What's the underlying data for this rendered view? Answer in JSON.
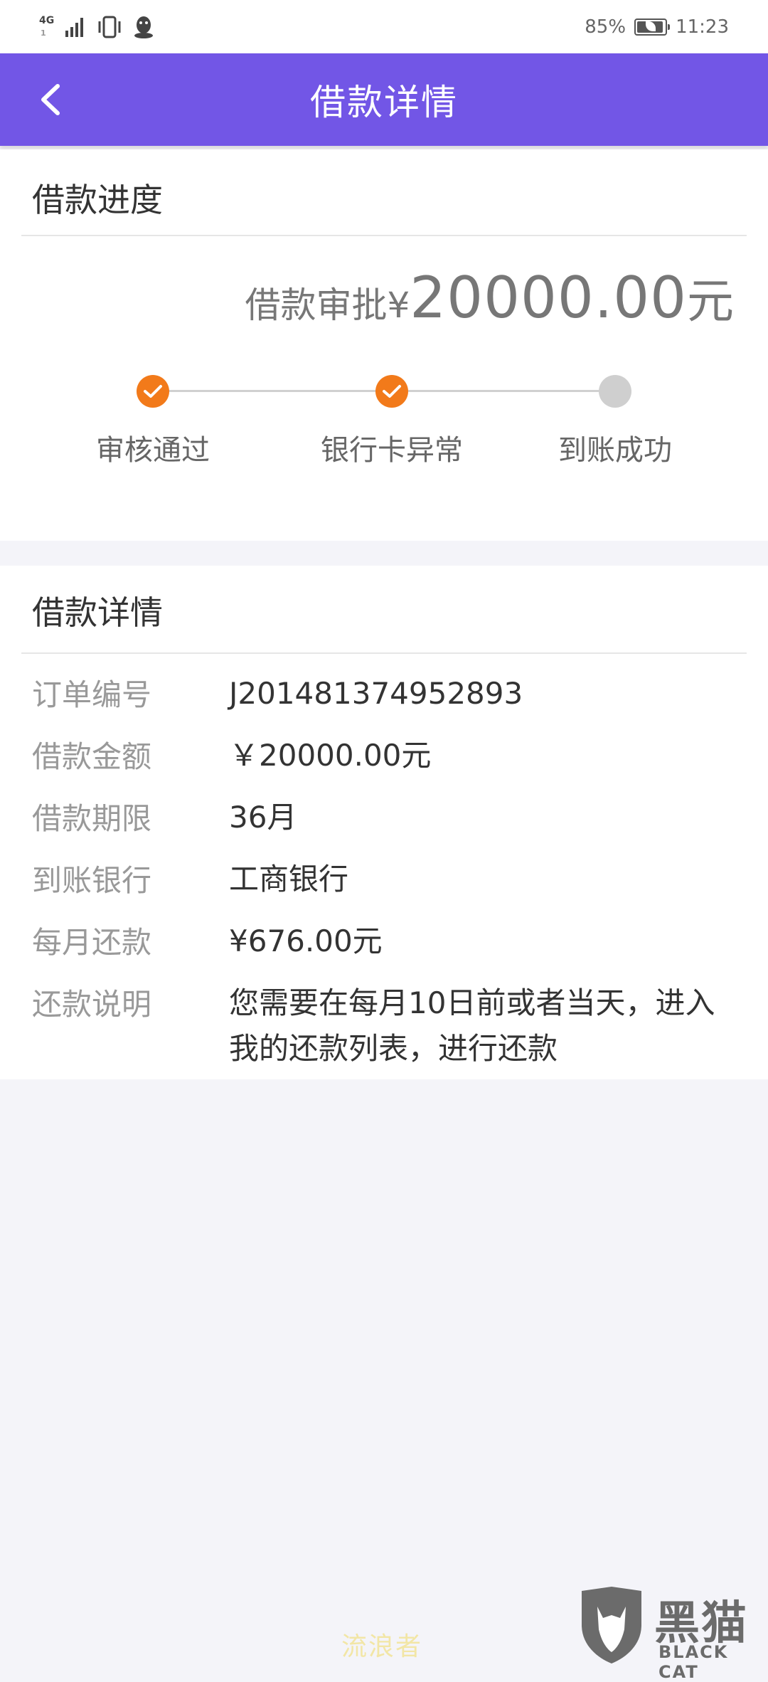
{
  "status_bar": {
    "network": "4G",
    "network_sub": "1",
    "battery_percent": "85%",
    "time": "11:23",
    "icons": [
      "signal-icon",
      "vibrate-icon",
      "qq-icon",
      "battery-icon"
    ]
  },
  "header": {
    "title": "借款详情",
    "back_icon": "chevron-left-icon",
    "color": "#7256e6"
  },
  "progress": {
    "section_title": "借款进度",
    "amount_prefix": "借款审批¥",
    "amount_value": "20000.00",
    "amount_unit": "元",
    "steps": [
      {
        "label": "审核通过",
        "done": true
      },
      {
        "label": "银行卡异常",
        "done": true
      },
      {
        "label": "到账成功",
        "done": false
      }
    ],
    "done_color": "#f27a1a"
  },
  "details": {
    "section_title": "借款详情",
    "rows": [
      {
        "label": "订单编号",
        "value": "J201481374952893"
      },
      {
        "label": "借款金额",
        "value": "￥20000.00元"
      },
      {
        "label": "借款期限",
        "value": "36月"
      },
      {
        "label": "到账银行",
        "value": "工商银行"
      },
      {
        "label": "每月还款",
        "value": "¥676.00元"
      },
      {
        "label": "还款说明",
        "value": "您需要在每月10日前或者当天，进入我的还款列表，进行还款"
      }
    ]
  },
  "watermark": {
    "text": "流浪者",
    "logo_cn": "黑猫",
    "logo_en": "BLACK CAT"
  }
}
